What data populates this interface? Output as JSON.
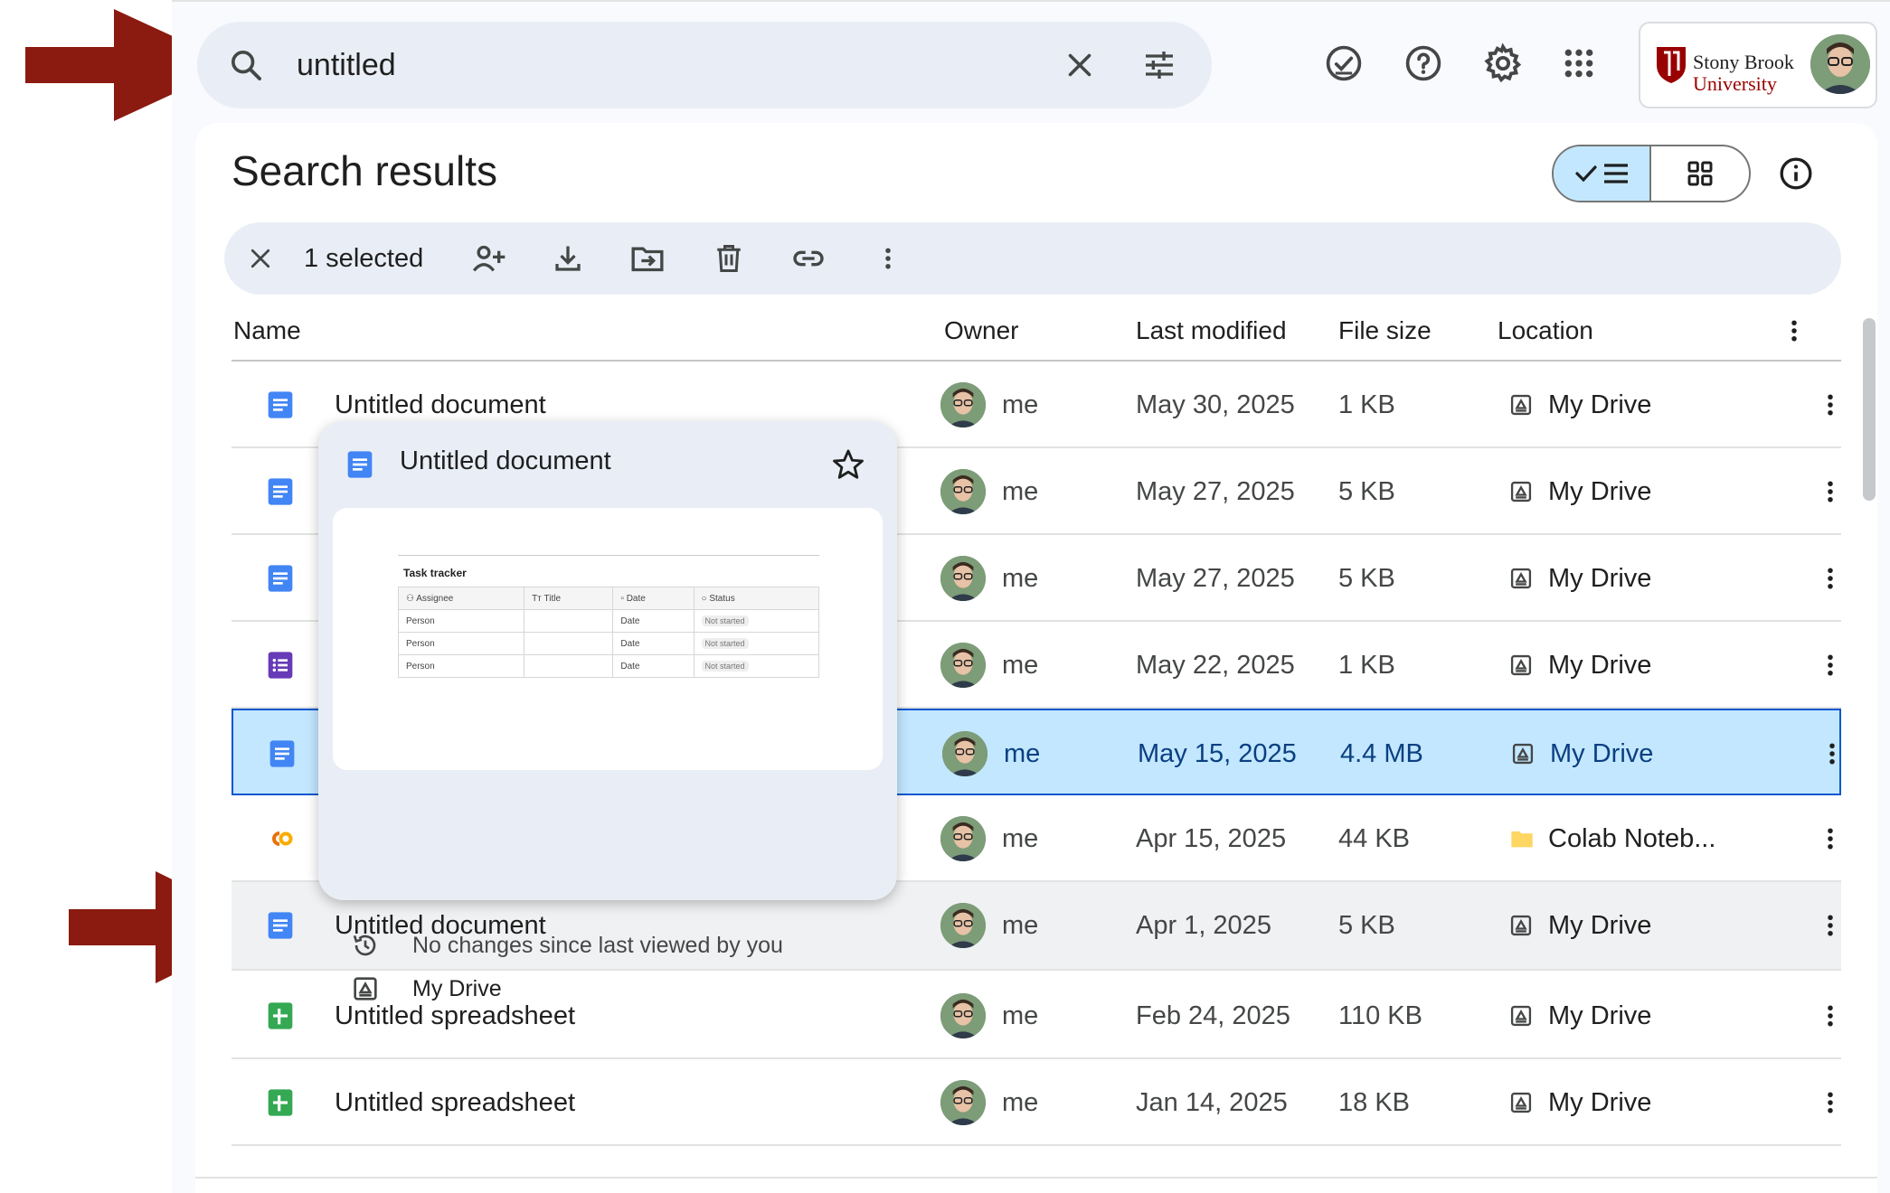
{
  "search": {
    "query": "untitled",
    "clear_icon": "close-icon",
    "filter_icon": "tune-icon"
  },
  "topbar": {
    "icons": [
      "offline-ready-icon",
      "help-icon",
      "settings-icon",
      "apps-grid-icon"
    ],
    "account": {
      "org_line1": "Stony Brook",
      "org_line2": "University",
      "brand_color": "#990000"
    }
  },
  "page": {
    "title": "Search results",
    "view_toggle": {
      "active": "list",
      "list_icon": "check-list-icon",
      "grid_icon": "grid-icon"
    },
    "info_icon": "info-icon"
  },
  "selection_bar": {
    "count_label": "1 selected",
    "actions": [
      "clear-selection",
      "share",
      "download",
      "move",
      "delete",
      "copy-link",
      "more"
    ]
  },
  "table": {
    "headers": {
      "name": "Name",
      "owner": "Owner",
      "last_modified": "Last modified",
      "file_size": "File size",
      "location": "Location"
    },
    "rows": [
      {
        "type": "doc",
        "name": "Untitled document",
        "owner": "me",
        "modified": "May 30, 2025",
        "size": "1 KB",
        "location": "My Drive",
        "location_type": "drive",
        "state": "normal"
      },
      {
        "type": "doc",
        "name": "",
        "owner": "me",
        "modified": "May 27, 2025",
        "size": "5 KB",
        "location": "My Drive",
        "location_type": "drive",
        "state": "normal"
      },
      {
        "type": "doc",
        "name": "",
        "owner": "me",
        "modified": "May 27, 2025",
        "size": "5 KB",
        "location": "My Drive",
        "location_type": "drive",
        "state": "normal"
      },
      {
        "type": "form",
        "name": "",
        "owner": "me",
        "modified": "May 22, 2025",
        "size": "1 KB",
        "location": "My Drive",
        "location_type": "drive",
        "state": "normal"
      },
      {
        "type": "doc",
        "name": "",
        "owner": "me",
        "modified": "May 15, 2025",
        "size": "4.4 MB",
        "location": "My Drive",
        "location_type": "drive",
        "state": "selected"
      },
      {
        "type": "colab",
        "name": "",
        "owner": "me",
        "modified": "Apr 15, 2025",
        "size": "44 KB",
        "location": "Colab Noteb...",
        "location_type": "folder",
        "state": "normal"
      },
      {
        "type": "doc",
        "name": "Untitled document",
        "owner": "me",
        "modified": "Apr 1, 2025",
        "size": "5 KB",
        "location": "My Drive",
        "location_type": "drive",
        "state": "hovered"
      },
      {
        "type": "sheet",
        "name": "Untitled spreadsheet",
        "owner": "me",
        "modified": "Feb 24, 2025",
        "size": "110 KB",
        "location": "My Drive",
        "location_type": "drive",
        "state": "normal"
      },
      {
        "type": "sheet",
        "name": "Untitled spreadsheet",
        "owner": "me",
        "modified": "Jan 14, 2025",
        "size": "18 KB",
        "location": "My Drive",
        "location_type": "drive",
        "state": "normal"
      }
    ]
  },
  "hover_card": {
    "title": "Untitled document",
    "preview": {
      "heading": "Task tracker",
      "columns": [
        "Assignee",
        "Title",
        "Date",
        "Status"
      ],
      "rows": [
        [
          "Person",
          "",
          "Date",
          "Not started"
        ],
        [
          "Person",
          "",
          "Date",
          "Not started"
        ],
        [
          "Person",
          "",
          "Date",
          "Not started"
        ]
      ]
    },
    "activity": "No changes since last viewed by you",
    "location": "My Drive"
  },
  "colors": {
    "accent": "#0b57d0",
    "selected_bg": "#c2e7ff",
    "annotation_arrow": "#8b1a10",
    "doc_blue": "#4285f4",
    "sheet_green": "#34a853",
    "form_purple": "#673ab7",
    "colab_orange": "#f9ab00"
  }
}
